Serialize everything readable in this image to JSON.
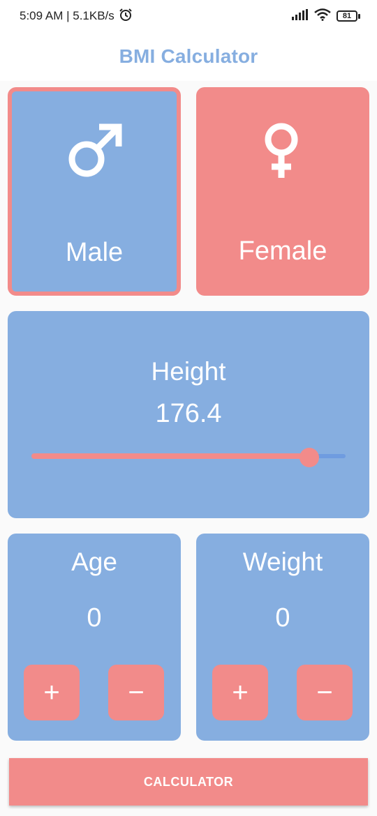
{
  "status_bar": {
    "time_speed": "5:09 AM | 5.1KB/s",
    "battery": "81",
    "icons": [
      "alarm-icon",
      "signal-icon",
      "wifi-icon",
      "battery-icon"
    ]
  },
  "app_bar": {
    "title": "BMI Calculator"
  },
  "gender": {
    "male_label": "Male",
    "female_label": "Female",
    "selected": "Male",
    "male_icon": "male-symbol-icon",
    "female_icon": "female-symbol-icon"
  },
  "height": {
    "label": "Height",
    "value": "176.4",
    "slider_fraction": 0.885
  },
  "age": {
    "label": "Age",
    "value": "0",
    "plus": "+",
    "minus": "−"
  },
  "weight": {
    "label": "Weight",
    "value": "0",
    "plus": "+",
    "minus": "−"
  },
  "calculate_button": {
    "label": "CALCULATOR"
  },
  "colors": {
    "card_blue": "#86aee0",
    "accent_pink": "#f28b8a",
    "title_blue": "#86aee0",
    "background": "#fafafa"
  }
}
